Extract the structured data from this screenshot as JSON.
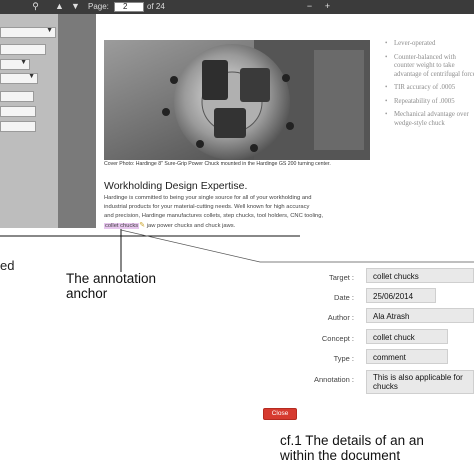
{
  "toolbar": {
    "page_label": "Page:",
    "page_value": "2",
    "page_total": "of 24"
  },
  "document": {
    "caption": "Cover Photo: Hardinge 8\" Sure-Grip Power Chuck mounted in the Hardinge GS 200 turning center.",
    "section_title": "Workholding Design Expertise.",
    "body_line1": "Hardinge is committed to being your single source for all of your workholding and",
    "body_line2": "industrial products for your material-cutting needs. Well known for high accuracy",
    "body_line3": "and precision, Hardinge manufactures collets, step chucks, tool holders, CNC tooling,",
    "body_anchor": "collet chucks",
    "body_after": "jaw power chucks and chuck jaws.",
    "bullets": [
      "Lever-operated",
      "Counter-balanced with counter weight to take advantage of centrifugal force",
      "TIR accuracy of .0005",
      "Repeatability of .0005",
      "Mechanical advantage over wedge-style chuck"
    ]
  },
  "labels": {
    "left_cut": "ed",
    "anchor_label": "The annotation anchor"
  },
  "details": {
    "target_label": "Target :",
    "target_value": "collet chucks",
    "date_label": "Date :",
    "date_value": "25/06/2014",
    "author_label": "Author :",
    "author_value": "Ala Atrash",
    "concept_label": "Concept :",
    "concept_value": "collet chuck",
    "type_label": "Type :",
    "type_value": "comment",
    "annotation_label": "Annotation :",
    "annotation_value": "This is also applicable for chucks",
    "close_label": "Close"
  },
  "figure_caption": {
    "line1": "cf.1 The details of an an",
    "line2": "within the document"
  },
  "colors": {
    "toolbar": "#3b3b3b",
    "highlight": "#e7c6ee",
    "close_button": "#d63a2f"
  }
}
